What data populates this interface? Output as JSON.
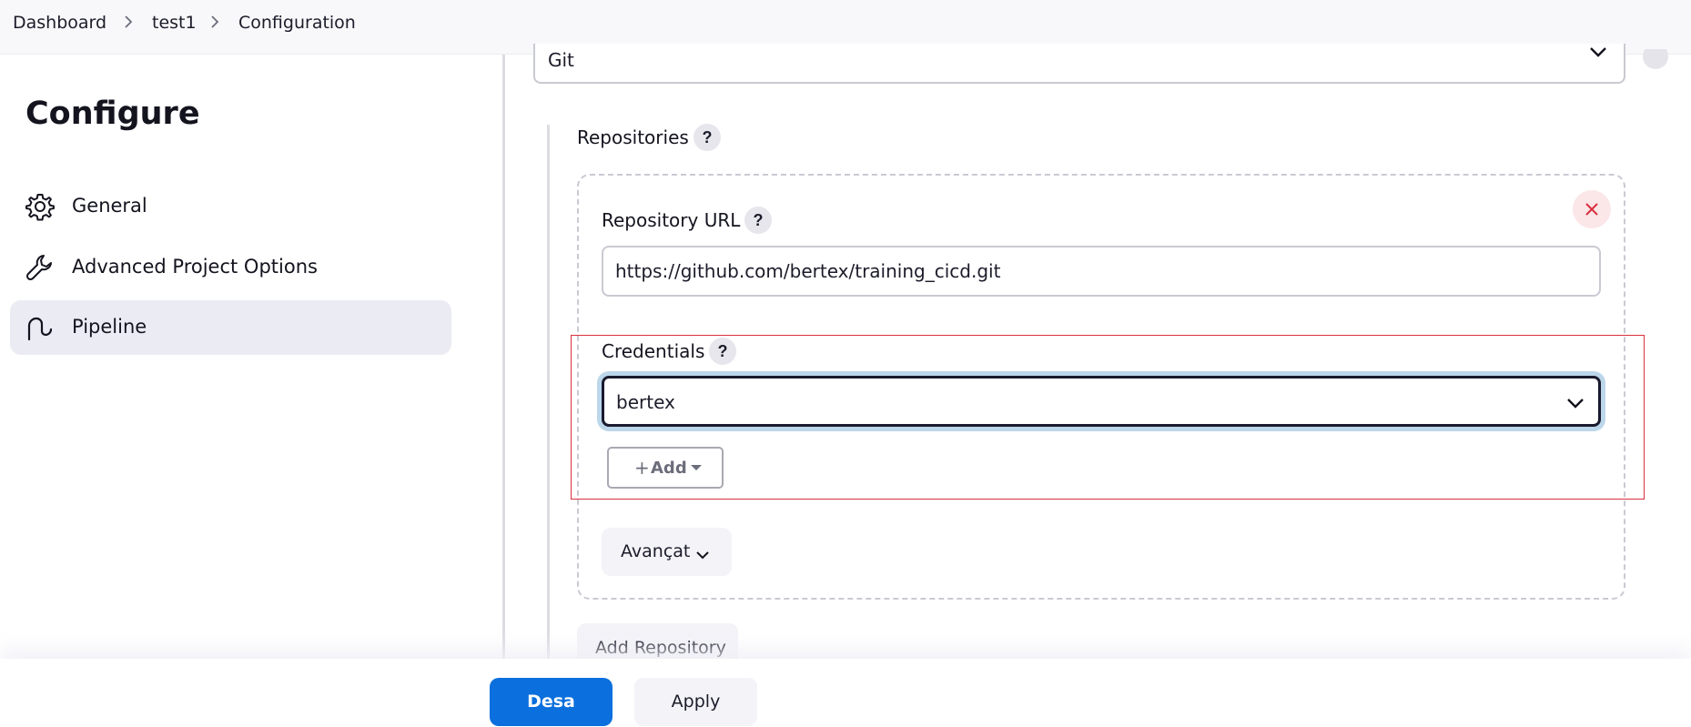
{
  "breadcrumb": {
    "items": [
      "Dashboard",
      "test1",
      "Configuration"
    ]
  },
  "sidebar": {
    "title": "Configure",
    "items": [
      {
        "label": "General",
        "icon": "gear-icon"
      },
      {
        "label": "Advanced Project Options",
        "icon": "wrench-icon"
      },
      {
        "label": "Pipeline",
        "icon": "pipeline-icon",
        "active": true
      }
    ]
  },
  "scm": {
    "selected": "Git"
  },
  "repositories": {
    "label": "Repositories",
    "help": "?",
    "repository_url_label": "Repository URL",
    "repository_url_value": "https://github.com/bertex/training_cicd.git",
    "credentials_label": "Credentials",
    "credentials_selected": "bertex",
    "add_plus": "+",
    "add_label": "Add",
    "advanced_label": "Avançat",
    "add_repository_label": "Add Repository"
  },
  "actions": {
    "save_label": "Desa",
    "apply_label": "Apply"
  },
  "colors": {
    "primary": "#0b6fdd",
    "highlight_border": "#d9303e",
    "focus_ring": "#bcd6ea",
    "active_nav_bg": "#ebebf3",
    "remove_icon": "#d9303e"
  }
}
